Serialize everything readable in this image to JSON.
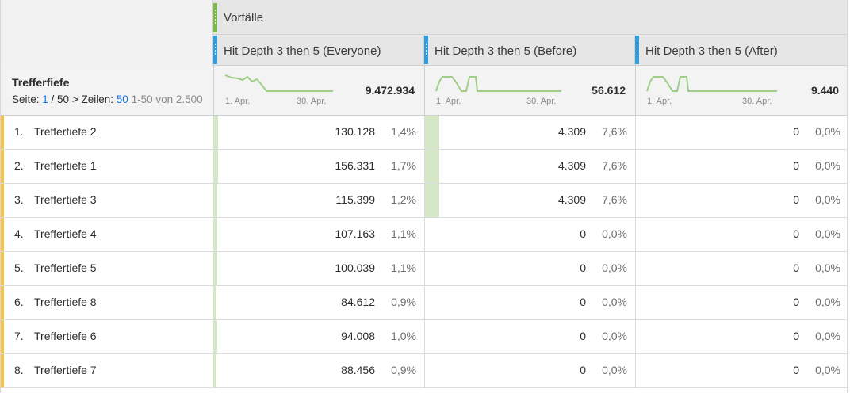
{
  "header": {
    "group_title": "Vorfälle",
    "columns": [
      {
        "label": "Hit Depth 3 then 5 (Everyone)"
      },
      {
        "label": "Hit Depth 3 then 5 (Before)"
      },
      {
        "label": "Hit Depth 3 then 5 (After)"
      }
    ]
  },
  "dimension": {
    "title": "Trefferfiefe",
    "pager": {
      "page_prefix": "Seite: ",
      "page_current": "1",
      "page_total": " / 50",
      "next_symbol": ">",
      "rows_label": "Zeilen: ",
      "rows_value": "50",
      "range": "1-50 von 2.500"
    }
  },
  "summary": [
    {
      "total": "9.472.934",
      "start_label": "1. Apr.",
      "end_label": "30. Apr."
    },
    {
      "total": "56.612",
      "start_label": "1. Apr.",
      "end_label": "30. Apr."
    },
    {
      "total": "9.440",
      "start_label": "1. Apr.",
      "end_label": "30. Apr."
    }
  ],
  "rows": [
    {
      "num": "1.",
      "name": "Treffertiefe 2",
      "cells": [
        {
          "value": "130.128",
          "pct": "1,4%",
          "fill": 0.014
        },
        {
          "value": "4.309",
          "pct": "7,6%",
          "fill": 0.076
        },
        {
          "value": "0",
          "pct": "0,0%",
          "fill": 0
        }
      ]
    },
    {
      "num": "2.",
      "name": "Treffertiefe 1",
      "cells": [
        {
          "value": "156.331",
          "pct": "1,7%",
          "fill": 0.017
        },
        {
          "value": "4.309",
          "pct": "7,6%",
          "fill": 0.076
        },
        {
          "value": "0",
          "pct": "0,0%",
          "fill": 0
        }
      ]
    },
    {
      "num": "3.",
      "name": "Treffertiefe 3",
      "cells": [
        {
          "value": "115.399",
          "pct": "1,2%",
          "fill": 0.012
        },
        {
          "value": "4.309",
          "pct": "7,6%",
          "fill": 0.076
        },
        {
          "value": "0",
          "pct": "0,0%",
          "fill": 0
        }
      ]
    },
    {
      "num": "4.",
      "name": "Treffertiefe 4",
      "cells": [
        {
          "value": "107.163",
          "pct": "1,1%",
          "fill": 0.011
        },
        {
          "value": "0",
          "pct": "0,0%",
          "fill": 0
        },
        {
          "value": "0",
          "pct": "0,0%",
          "fill": 0
        }
      ]
    },
    {
      "num": "5.",
      "name": "Treffertiefe 5",
      "cells": [
        {
          "value": "100.039",
          "pct": "1,1%",
          "fill": 0.011
        },
        {
          "value": "0",
          "pct": "0,0%",
          "fill": 0
        },
        {
          "value": "0",
          "pct": "0,0%",
          "fill": 0
        }
      ]
    },
    {
      "num": "6.",
      "name": "Treffertiefe 8",
      "cells": [
        {
          "value": "84.612",
          "pct": "0,9%",
          "fill": 0.009
        },
        {
          "value": "0",
          "pct": "0,0%",
          "fill": 0
        },
        {
          "value": "0",
          "pct": "0,0%",
          "fill": 0
        }
      ]
    },
    {
      "num": "7.",
      "name": "Treffertiefe 6",
      "cells": [
        {
          "value": "94.008",
          "pct": "1,0%",
          "fill": 0.01
        },
        {
          "value": "0",
          "pct": "0,0%",
          "fill": 0
        },
        {
          "value": "0",
          "pct": "0,0%",
          "fill": 0
        }
      ]
    },
    {
      "num": "8.",
      "name": "Treffertiefe 7",
      "cells": [
        {
          "value": "88.456",
          "pct": "0,9%",
          "fill": 0.009
        },
        {
          "value": "0",
          "pct": "0,0%",
          "fill": 0
        },
        {
          "value": "0",
          "pct": "0,0%",
          "fill": 0
        }
      ]
    }
  ],
  "colors": {
    "group_marker": "#7cbb48",
    "column_marker": "#2d9ee0",
    "row_accent": "#f5c142",
    "bar_fill": "#d5e7c6",
    "sparkline": "#9fcf86",
    "link_blue": "#1473e6"
  }
}
